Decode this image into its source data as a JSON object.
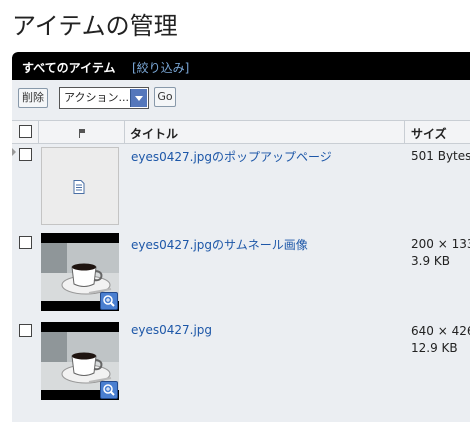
{
  "page": {
    "title": "アイテムの管理"
  },
  "header": {
    "title": "すべてのアイテム",
    "filter_link": "[絞り込み]"
  },
  "toolbar": {
    "delete_label": "削除",
    "action_select_value": "アクション...",
    "go_label": "Go"
  },
  "table": {
    "columns": {
      "title": "タイトル",
      "size": "サイズ"
    },
    "rows": [
      {
        "title": "eyes0427.jpgのポップアップページ",
        "size_line1": "501 Bytes",
        "size_line2": ""
      },
      {
        "title": "eyes0427.jpgのサムネール画像",
        "size_line1": "200 × 133",
        "size_line2": "3.9 KB"
      },
      {
        "title": "eyes0427.jpg",
        "size_line1": "640 × 426",
        "size_line2": "12.9 KB"
      }
    ]
  },
  "icons": {
    "flag": "flag-icon",
    "document": "document-icon",
    "zoom": "zoom-icon",
    "dropdown": "chevron-down-icon"
  },
  "colors": {
    "header_bg": "#000000",
    "link": "#1d57a8",
    "filter_link": "#7aa7d6",
    "panel_bg": "#ebeef2"
  }
}
